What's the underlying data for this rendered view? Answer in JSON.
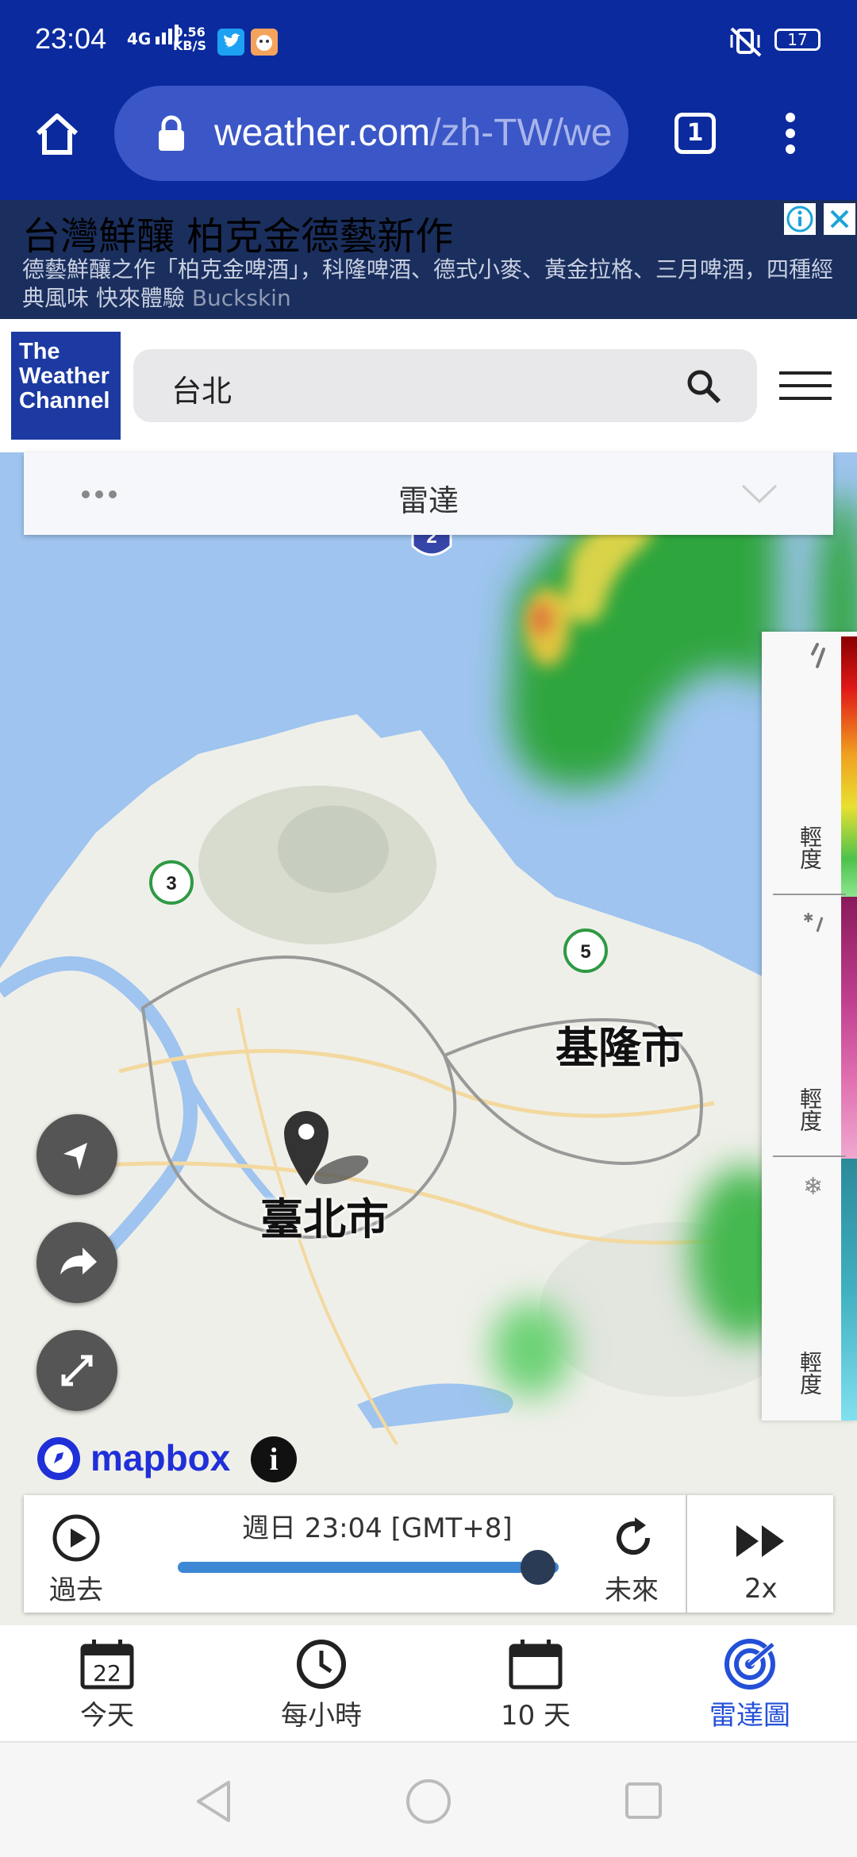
{
  "status_bar": {
    "time": "23:04",
    "network": "4G",
    "speed_value": "0.56",
    "speed_unit": "KB/S",
    "battery": "17"
  },
  "browser": {
    "url_domain": "weather.com",
    "url_path": "/zh-TW/we",
    "tab_count": "1"
  },
  "ad": {
    "title": "台灣鮮釀 柏克金德藝新作",
    "body": "德藝鮮釀之作「柏克金啤酒」，科隆啤酒、德式小麥、黃金拉格、三月啤酒，四種經典風味 快來體驗",
    "brand": "Buckskin"
  },
  "header": {
    "logo_lines": [
      "The",
      "Weather",
      "Channel"
    ],
    "search_value": "台北"
  },
  "map": {
    "layer_label": "雷達",
    "cities": [
      "基隆市",
      "臺北市"
    ],
    "route_badges": [
      "2",
      "3",
      "5"
    ],
    "legend_labels": [
      "輕度",
      "輕度",
      "輕度"
    ],
    "attribution": "mapbox",
    "attribution_info": "i"
  },
  "timeline": {
    "past_label": "過去",
    "time_text": "週日 23:04 [GMT+8]",
    "future_label": "未來",
    "speed_label": "2x",
    "progress": 0.98
  },
  "bottom_nav": {
    "today_day": "22",
    "items": [
      "今天",
      "每小時",
      "10 天",
      "雷達圖"
    ],
    "active_color": "#2450d8"
  }
}
